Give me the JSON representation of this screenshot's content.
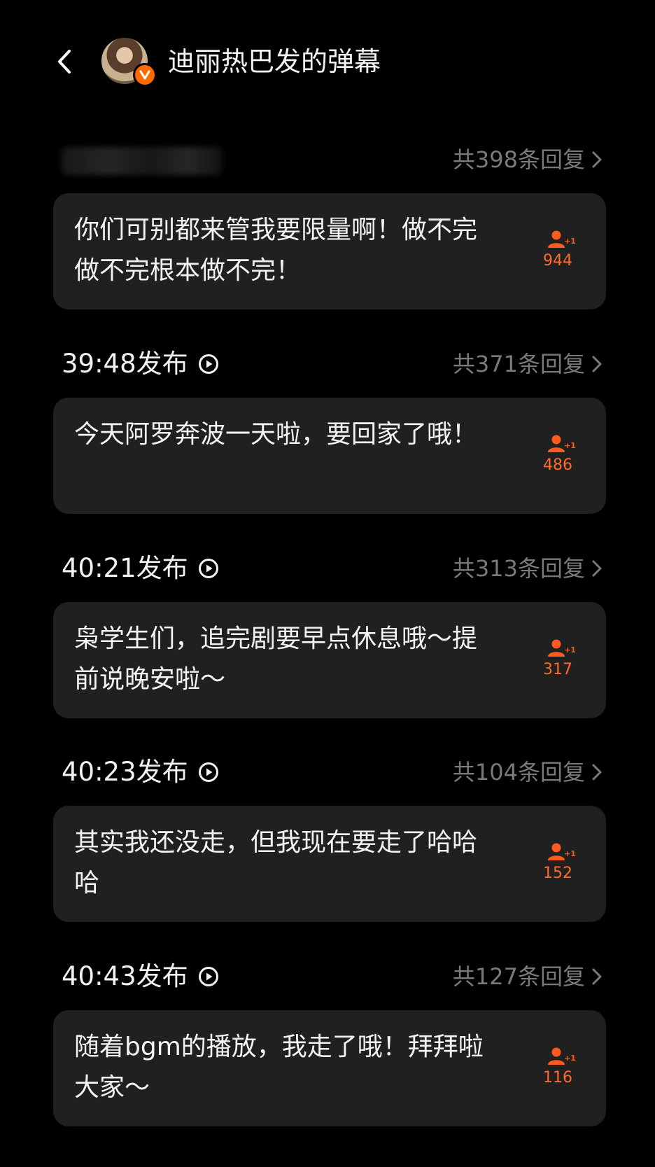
{
  "header": {
    "back_icon": "chevron-left-icon",
    "title": "迪丽热巴发的弹幕",
    "verified_badge_letter": "V",
    "accent_color": "#ff6a00"
  },
  "items": [
    {
      "publish_time": "",
      "replies": "共398条回复",
      "text": "你们可别都来管我要限量啊！做不完做不完根本做不完！",
      "likes": "944"
    },
    {
      "publish_time": "39:48发布",
      "replies": "共371条回复",
      "text": "今天阿罗奔波一天啦，要回家了哦！",
      "likes": "486"
    },
    {
      "publish_time": "40:21发布",
      "replies": "共313条回复",
      "text": "枭学生们，追完剧要早点休息哦～提前说晚安啦～",
      "likes": "317"
    },
    {
      "publish_time": "40:23发布",
      "replies": "共104条回复",
      "text": "其实我还没走，但我现在要走了哈哈哈",
      "likes": "152"
    },
    {
      "publish_time": "40:43发布",
      "replies": "共127条回复",
      "text": "随着bgm的播放，我走了哦！拜拜啦大家～",
      "likes": "116"
    }
  ]
}
